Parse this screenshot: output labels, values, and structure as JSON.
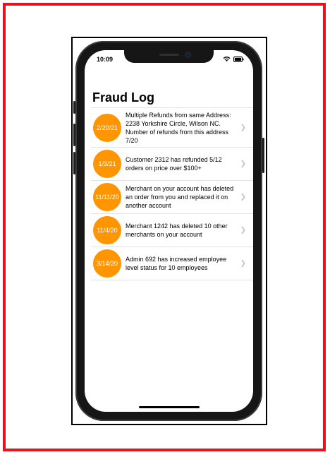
{
  "status_bar": {
    "time": "10:09",
    "icons": [
      "wifi-icon",
      "battery-icon"
    ]
  },
  "page": {
    "title": "Fraud Log"
  },
  "fraud_entries": [
    {
      "date": "2/20/21",
      "message": "Multiple Refunds from same Address: 2238 Yorkshire Circle, Wilson NC. Number of refunds from this address 7/20"
    },
    {
      "date": "1/3/21",
      "message": "Customer 2312 has refunded 5/12 orders on price over $100+"
    },
    {
      "date": "11/11/20",
      "message": "Merchant on your account has deleted an order from you and replaced it on another account"
    },
    {
      "date": "11/4/20",
      "message": "Merchant 1242 has deleted 10 other merchants on your account"
    },
    {
      "date": "3/14/20",
      "message": "Admin 692 has increased employee level status for 10 employees"
    }
  ],
  "colors": {
    "badge": "#ff9500",
    "frame": "#e8131b"
  }
}
